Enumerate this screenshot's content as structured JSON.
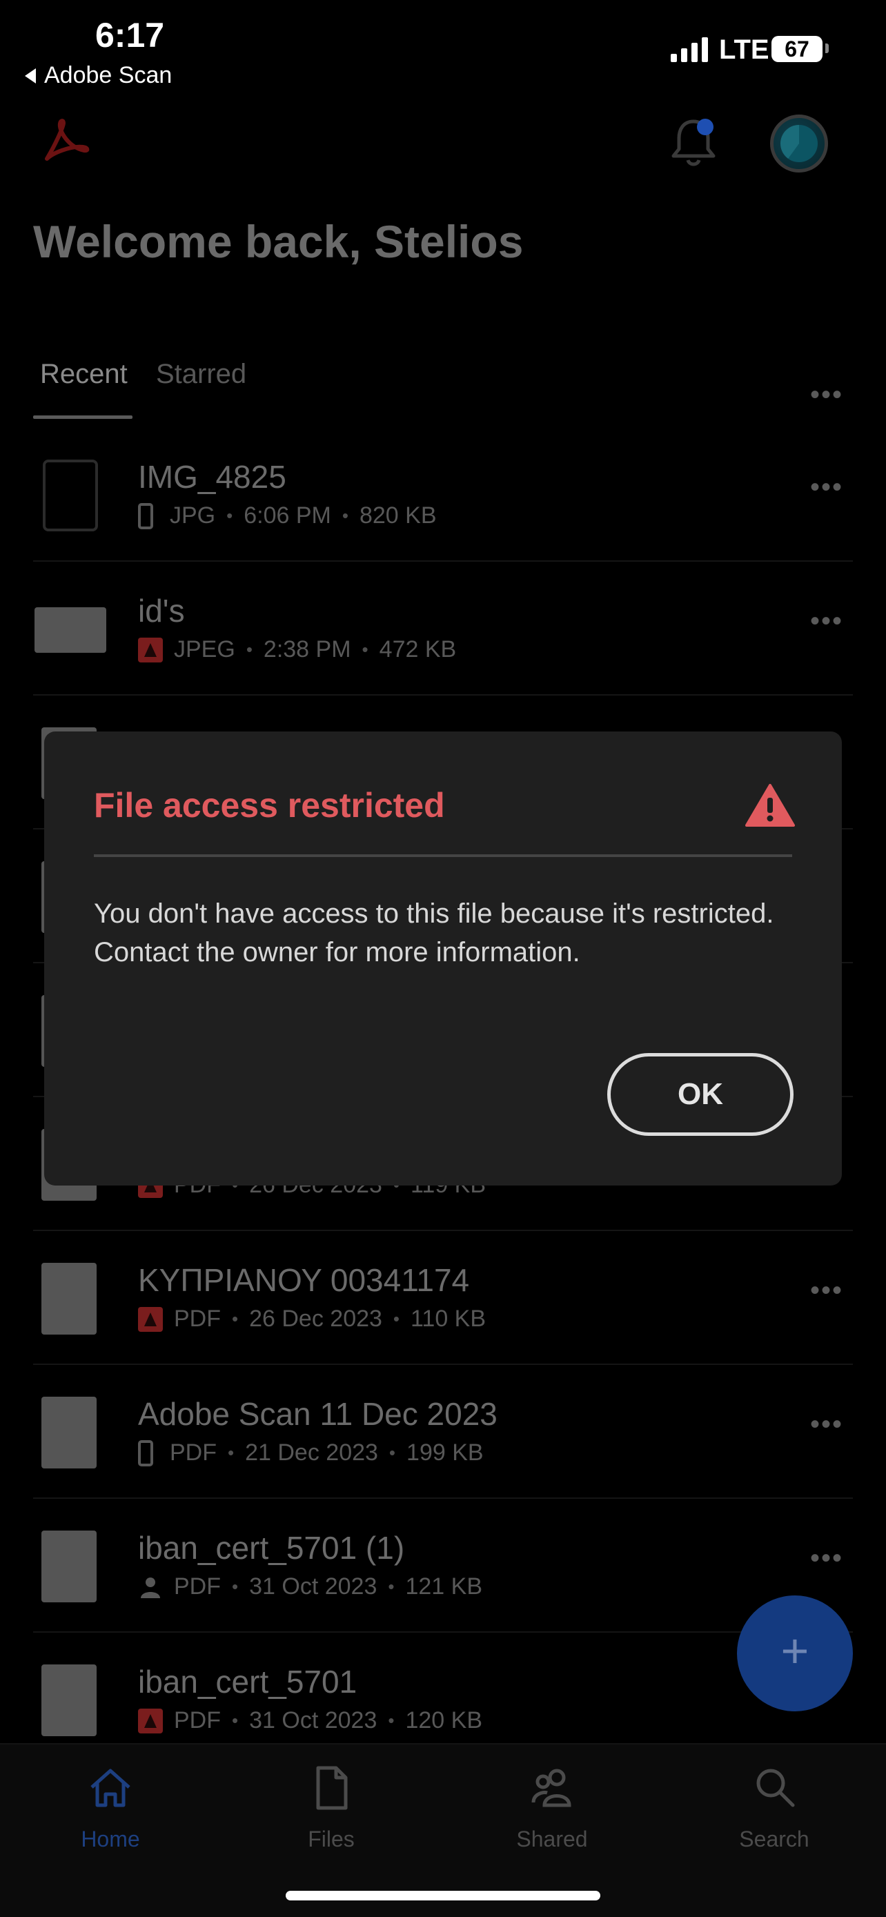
{
  "status_bar": {
    "time": "6:17",
    "back_app": "Adobe Scan",
    "network": "LTE",
    "battery": "67"
  },
  "header": {
    "welcome": "Welcome back, Stelios"
  },
  "tabs": {
    "recent": "Recent",
    "starred": "Starred"
  },
  "files": [
    {
      "name": "IMG_4825",
      "type": "JPG",
      "date": "6:06 PM",
      "size": "820 KB",
      "source": "phone"
    },
    {
      "name": "id's",
      "type": "JPEG",
      "date": "2:38 PM",
      "size": "472 KB",
      "source": "acrobat"
    },
    {
      "name": "",
      "type": "",
      "date": "",
      "size": "",
      "source": ""
    },
    {
      "name": "",
      "type": "",
      "date": "",
      "size": "",
      "source": ""
    },
    {
      "name": "",
      "type": "",
      "date": "",
      "size": "",
      "source": ""
    },
    {
      "name": "",
      "type": "PDF",
      "date": "26 Dec 2023",
      "size": "119 KB",
      "source": "acrobat"
    },
    {
      "name": "ΚΥΠΡΙΑΝΟΥ 00341174",
      "type": "PDF",
      "date": "26 Dec 2023",
      "size": "110 KB",
      "source": "acrobat"
    },
    {
      "name": "Adobe Scan 11 Dec 2023",
      "type": "PDF",
      "date": "21 Dec 2023",
      "size": "199 KB",
      "source": "phone"
    },
    {
      "name": "iban_cert_5701 (1)",
      "type": "PDF",
      "date": "31 Oct 2023",
      "size": "121 KB",
      "source": "shared"
    },
    {
      "name": "iban_cert_5701",
      "type": "PDF",
      "date": "31 Oct 2023",
      "size": "120 KB",
      "source": "acrobat"
    }
  ],
  "fab": {
    "label": "+"
  },
  "bottom_nav": {
    "home": "Home",
    "files": "Files",
    "shared": "Shared",
    "search": "Search"
  },
  "dialog": {
    "title": "File access restricted",
    "body": "You don't have access to this file because it's restricted. Contact the owner for more information.",
    "ok": "OK"
  },
  "colors": {
    "accent_blue": "#1e4fb2",
    "error_red": "#e05a5e",
    "dialog_bg": "#1f1f1f"
  }
}
